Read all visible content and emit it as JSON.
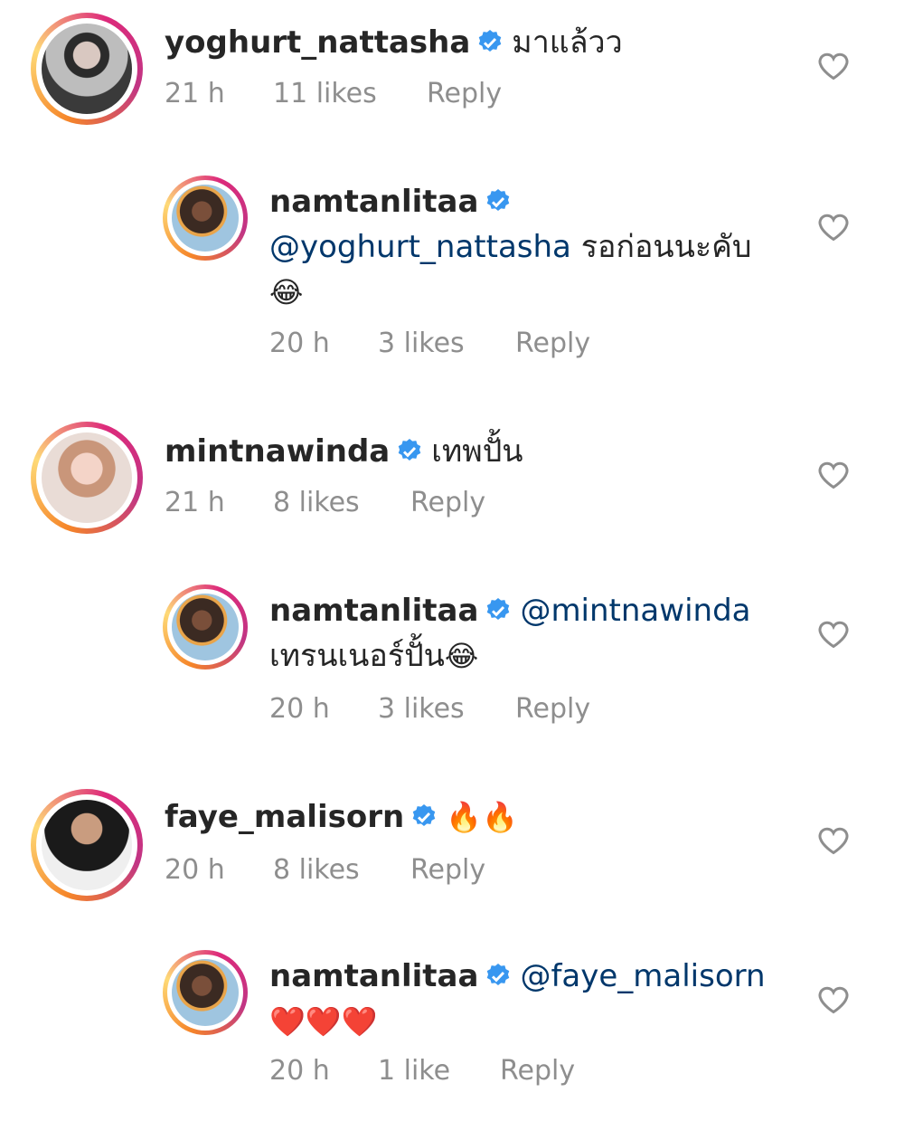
{
  "comments": [
    {
      "username": "yoghurt_nattasha",
      "text": "มาแล้วว",
      "time": "21 h",
      "likes": "11 likes",
      "reply_label": "Reply",
      "avatar": "photo-a",
      "replies": [
        {
          "username": "namtanlitaa",
          "mention": "@yoghurt_nattasha",
          "text": "รอก่อนนะคับ",
          "emoji": "😂",
          "time": "20 h",
          "likes": "3 likes",
          "reply_label": "Reply",
          "avatar": "photo-n"
        }
      ]
    },
    {
      "username": "mintnawinda",
      "text": "เทพปั้น",
      "time": "21 h",
      "likes": "8 likes",
      "reply_label": "Reply",
      "avatar": "photo-b",
      "replies": [
        {
          "username": "namtanlitaa",
          "mention": "@mintnawinda",
          "text": "เทรนเนอร์ปั้น",
          "emoji": "😂",
          "time": "20 h",
          "likes": "3 likes",
          "reply_label": "Reply",
          "avatar": "photo-n"
        }
      ]
    },
    {
      "username": "faye_malisorn",
      "text": "🔥🔥",
      "time": "20 h",
      "likes": "8 likes",
      "reply_label": "Reply",
      "avatar": "photo-c",
      "replies": [
        {
          "username": "namtanlitaa",
          "mention": "@faye_malisorn",
          "text": "❤️❤️❤️",
          "emoji": "",
          "time": "20 h",
          "likes": "1 like",
          "reply_label": "Reply",
          "avatar": "photo-n"
        }
      ]
    }
  ],
  "icons": {
    "verified": "verified-badge-icon",
    "like": "heart-outline-icon"
  },
  "colors": {
    "verified_blue": "#3897f0",
    "mention": "#00376b",
    "meta_gray": "#8e8e8e",
    "heart_gray": "#8e8e8e"
  }
}
